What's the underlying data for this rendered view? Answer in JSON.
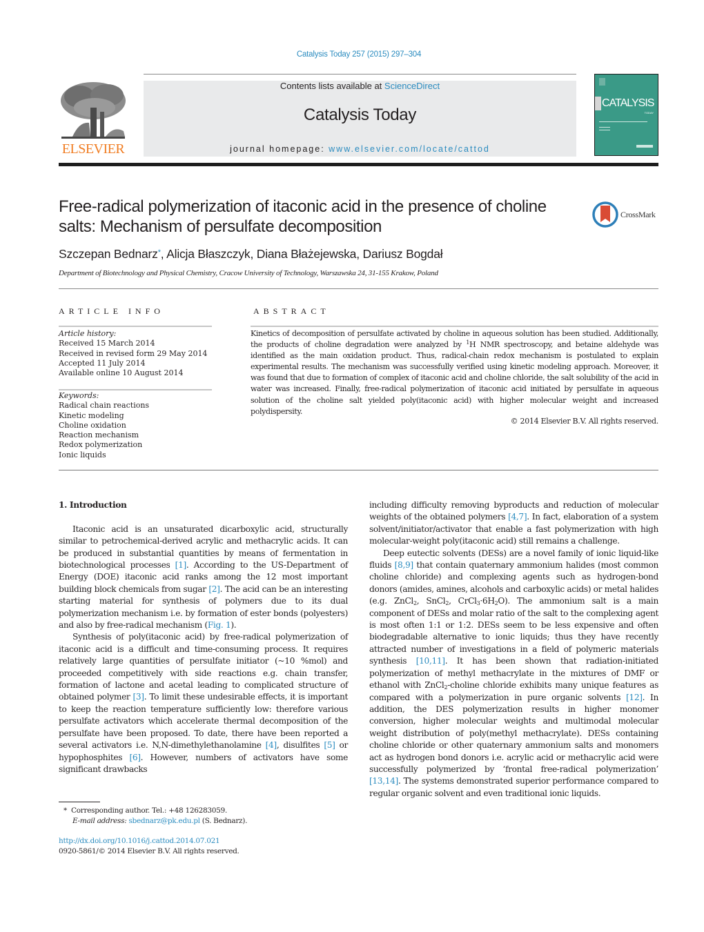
{
  "header": {
    "journal_reference": "Catalysis Today 257 (2015) 297–304",
    "contents_prefix": "Contents lists available at ",
    "contents_link": "ScienceDirect",
    "journal_title": "Catalysis Today",
    "homepage_prefix": "journal homepage: ",
    "homepage_link": "www.elsevier.com/locate/cattod",
    "publisher_logo_text": "ELSEVIER",
    "cover_title": "CATALYSIS",
    "cover_subtitle": "TODAY",
    "colors": {
      "link": "#2a8bbf",
      "elsevier_orange": "#f07d23",
      "cover_teal": "#3a9a87",
      "masthead_gray": "#e9eaeb"
    }
  },
  "article": {
    "title": "Free-radical polymerization of itaconic acid in the presence of choline salts: Mechanism of persulfate decomposition",
    "crossmark_label": "CrossMark",
    "authors": [
      {
        "name": "Szczepan Bednarz",
        "mark": "*"
      },
      {
        "name": "Alicja Błaszczyk"
      },
      {
        "name": "Diana Błażejewska"
      },
      {
        "name": "Dariusz Bogdał"
      }
    ],
    "affiliation": "Department of Biotechnology and Physical Chemistry, Cracow University of Technology, Warszawska 24, 31-155 Krakow, Poland"
  },
  "article_info": {
    "heading": "ARTICLE INFO",
    "history_label": "Article history:",
    "history": [
      "Received 15 March 2014",
      "Received in revised form 29 May 2014",
      "Accepted 11 July 2014",
      "Available online 10 August 2014"
    ],
    "keywords_label": "Keywords:",
    "keywords": [
      "Radical chain reactions",
      "Kinetic modeling",
      "Choline oxidation",
      "Reaction mechanism",
      "Redox polymerization",
      "Ionic liquids"
    ]
  },
  "abstract": {
    "heading": "ABSTRACT",
    "text_part1": "Kinetics of decomposition of persulfate activated by choline in aqueous solution has been studied. Additionally, the products of choline degradation were analyzed by ",
    "nmr_sup": "1",
    "text_part2": "H NMR spectroscopy, and betaine aldehyde was identified as the main oxidation product. Thus, radical-chain redox mechanism is postulated to explain experimental results. The mechanism was successfully verified using kinetic modeling approach. Moreover, it was found that due to formation of complex of itaconic acid and choline chloride, the salt solubility of the acid in water was increased. Finally, free-radical polymerization of itaconic acid initiated by persulfate in aqueous solution of the choline salt yielded poly(itaconic acid) with higher molecular weight and increased polydispersity.",
    "copyright": "© 2014 Elsevier B.V. All rights reserved."
  },
  "body": {
    "section_heading": "1.  Introduction",
    "p1": {
      "t1": "Itaconic acid is an unsaturated dicarboxylic acid, structurally similar to petrochemical-derived acrylic and methacrylic acids. It can be produced in substantial quantities by means of fermentation in biotechnological processes ",
      "r1": "[1]",
      "t2": ". According to the US-Department of Energy (DOE) itaconic acid ranks among the 12 most important building block chemicals from sugar ",
      "r2": "[2]",
      "t3": ". The acid can be an interesting starting material for synthesis of polymers due to its dual polymerization mechanism i.e. by formation of ester bonds (polyesters) and also by free-radical mechanism (",
      "r3": "Fig. 1",
      "t4": ")."
    },
    "p2": {
      "t1": "Synthesis of poly(itaconic acid) by free-radical polymerization of itaconic acid is a difficult and time-consuming process. It requires relatively large quantities of persulfate initiator (~10 %mol) and proceeded competitively with side reactions e.g. chain transfer, formation of lactone and acetal leading to complicated structure of obtained polymer ",
      "r1": "[3]",
      "t2": ". To limit these undesirable effects, it is important to keep the reaction temperature sufficiently low: therefore various persulfate activators which accelerate thermal decomposition of the persulfate have been proposed. To date, there have been reported a several activators i.e. N,N-dimethylethanolamine ",
      "r2": "[4]",
      "t3": ", disulfites ",
      "r3": "[5]",
      "t4": " or hypophosphites ",
      "r4": "[6]",
      "t5": ". However, numbers of activators have some significant drawbacks"
    },
    "p3": {
      "t1": "including difficulty removing byproducts and reduction of molecular weights of the obtained polymers ",
      "r1": "[4,7]",
      "t2": ". In fact, elaboration of a system solvent/initiator/activator that enable a fast polymerization with high molecular-weight poly(itaconic acid) still remains a challenge."
    },
    "p4": {
      "t1": "Deep eutectic solvents (DESs) are a novel family of ionic liquid-like fluids ",
      "r1": "[8,9]",
      "t2": " that contain quaternary ammonium halides (most common choline chloride) and complexing agents such as hydrogen-bond donors (amides, amines, alcohols and carboxylic acids) or metal halides (e.g. ZnCl",
      "s1": "2",
      "t3": ", SnCl",
      "s2": "2",
      "t4": ", CrCl",
      "s3": "3",
      "t5": "·6H",
      "s4": "2",
      "t6": "O). The ammonium salt is a main component of DESs and molar ratio of the salt to the complexing agent is most often 1:1 or 1:2. DESs seem to be less expensive and often biodegradable alternative to ionic liquids; thus they have recently attracted number of investigations in a field of polymeric materials synthesis ",
      "r2": "[10,11]",
      "t7": ". It has been shown that radiation-initiated polymerization of methyl methacrylate in the mixtures of DMF or ethanol with ZnCl",
      "s5": "2",
      "t8": "-choline chloride exhibits many unique features as compared with a polymerization in pure organic solvents ",
      "r3": "[12]",
      "t9": ". In addition, the DES polymerization results in higher monomer conversion, higher molecular weights and multimodal molecular weight distribution of poly(methyl methacrylate). DESs containing choline chloride or other quaternary ammonium salts and monomers act as hydrogen bond donors i.e. acrylic acid or methacrylic acid were successfully polymerized by ‘frontal free-radical polymerization’ ",
      "r4": "[13,14]",
      "t10": ". The systems demonstrated superior performance compared to regular organic solvent and even traditional ionic liquids."
    }
  },
  "footnote": {
    "mark": "*",
    "corresponding": "Corresponding author. Tel.: +48 126283059.",
    "email_label": "E-mail address: ",
    "email": "sbednarz@pk.edu.pl",
    "email_suffix": " (S. Bednarz)."
  },
  "doi": {
    "url": "http://dx.doi.org/10.1016/j.cattod.2014.07.021",
    "issn_line": "0920-5861/© 2014 Elsevier B.V. All rights reserved."
  }
}
